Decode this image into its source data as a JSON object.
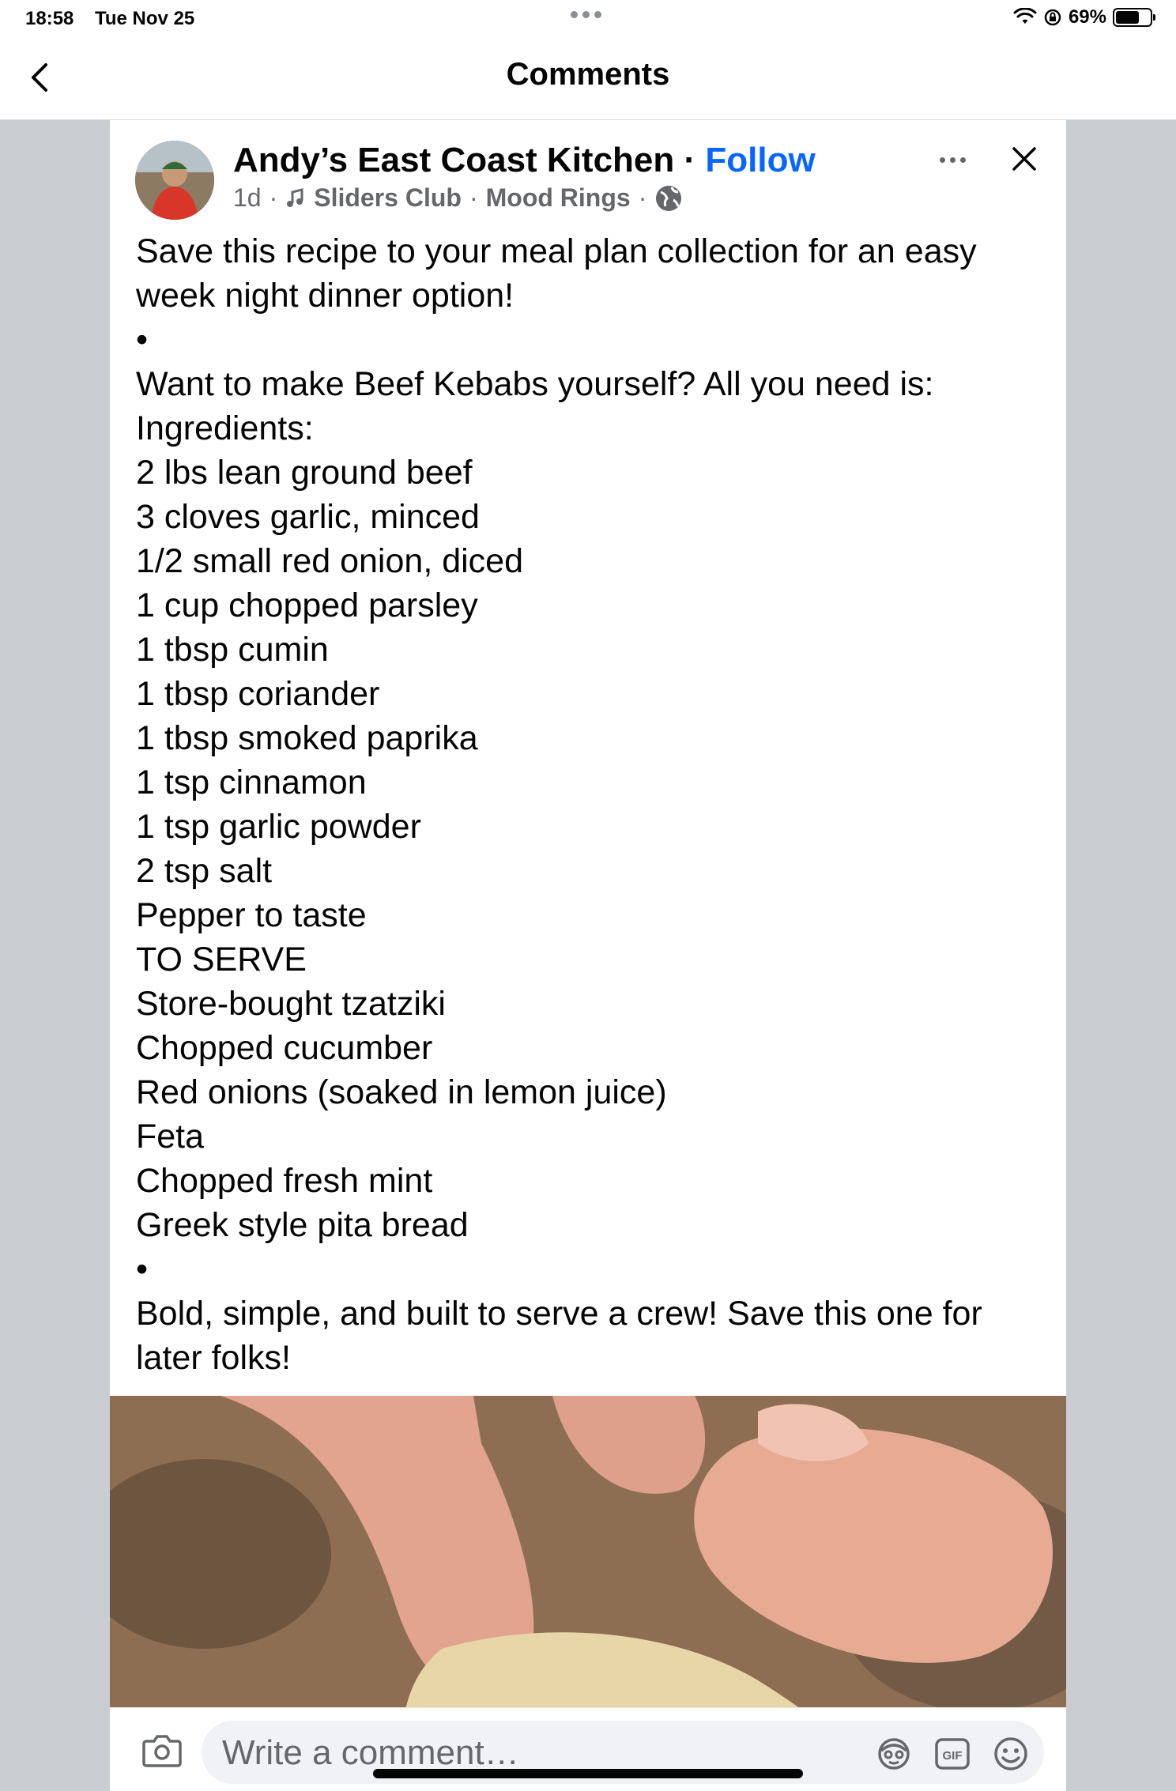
{
  "status_bar": {
    "time": "18:58",
    "date": "Tue Nov 25",
    "battery": "69%",
    "battery_level": 0.69
  },
  "nav": {
    "title": "Comments"
  },
  "post": {
    "author": "Andy’s East Coast Kitchen",
    "separator": "·",
    "follow_label": "Follow",
    "age": "1d",
    "meta_dot": "·",
    "music_artist": "Sliders Club",
    "music_dot": "·",
    "music_track": "Mood Rings",
    "body_lines": [
      "Save this recipe to your meal plan collection for an easy",
      "week night dinner option!",
      "•",
      "Want to make Beef Kebabs yourself? All you need is:",
      "Ingredients:",
      "2 lbs lean ground beef",
      "3 cloves garlic, minced",
      "1/2 small red onion, diced",
      "1 cup chopped parsley",
      "1 tbsp cumin",
      "1 tbsp coriander",
      "1 tbsp smoked paprika",
      "1 tsp cinnamon",
      "1 tsp garlic powder",
      "2 tsp salt",
      "Pepper to taste",
      "TO SERVE",
      "Store-bought tzatziki",
      "Chopped cucumber",
      "Red onions (soaked in lemon juice)",
      "Feta",
      "Chopped fresh mint",
      "Greek style pita bread",
      "•",
      "Bold, simple, and built to serve a crew! Save this one for",
      "later folks!"
    ]
  },
  "composer": {
    "placeholder": "Write a comment…",
    "gif_label": "GIF"
  },
  "colors": {
    "accent": "#0866ff",
    "background": "#c9ccd1",
    "secondary_text": "#65676b"
  },
  "icons": [
    "back-chevron-icon",
    "more-icon",
    "close-icon",
    "music-note-icon",
    "globe-icon",
    "camera-icon",
    "avatar-sticker-icon",
    "gif-icon",
    "emoji-icon"
  ]
}
